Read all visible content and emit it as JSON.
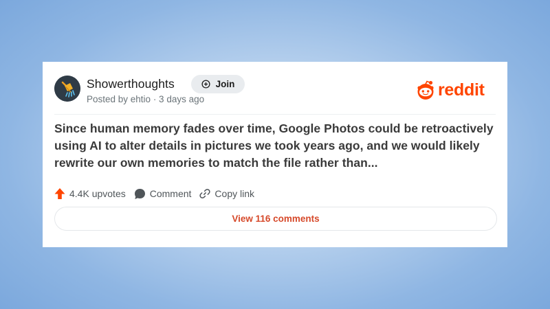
{
  "post": {
    "subreddit": "Showerthoughts",
    "join_label": "Join",
    "posted_by": "Posted by ehtio · 3 days ago",
    "title": "Since human memory fades over time, Google Photos could be retroactively using AI to alter details in pictures we took years ago, and we would likely rewrite our own memories to match the file rather than...",
    "upvotes": "4.4K upvotes",
    "comment_label": "Comment",
    "copy_link_label": "Copy link",
    "view_comments_label": "View 116 comments"
  },
  "brand": {
    "wordmark": "reddit",
    "color": "#ff4500"
  },
  "icons": {
    "avatar": "showerhead-icon",
    "join": "plus-circle-icon",
    "upvote": "upvote-arrow-icon",
    "comment": "comment-bubble-icon",
    "copy_link": "link-icon",
    "logo": "reddit-snoo-icon"
  },
  "colors": {
    "upvote": "#ff4500",
    "link_text": "#d6492a",
    "background": "#9fc1e8"
  }
}
